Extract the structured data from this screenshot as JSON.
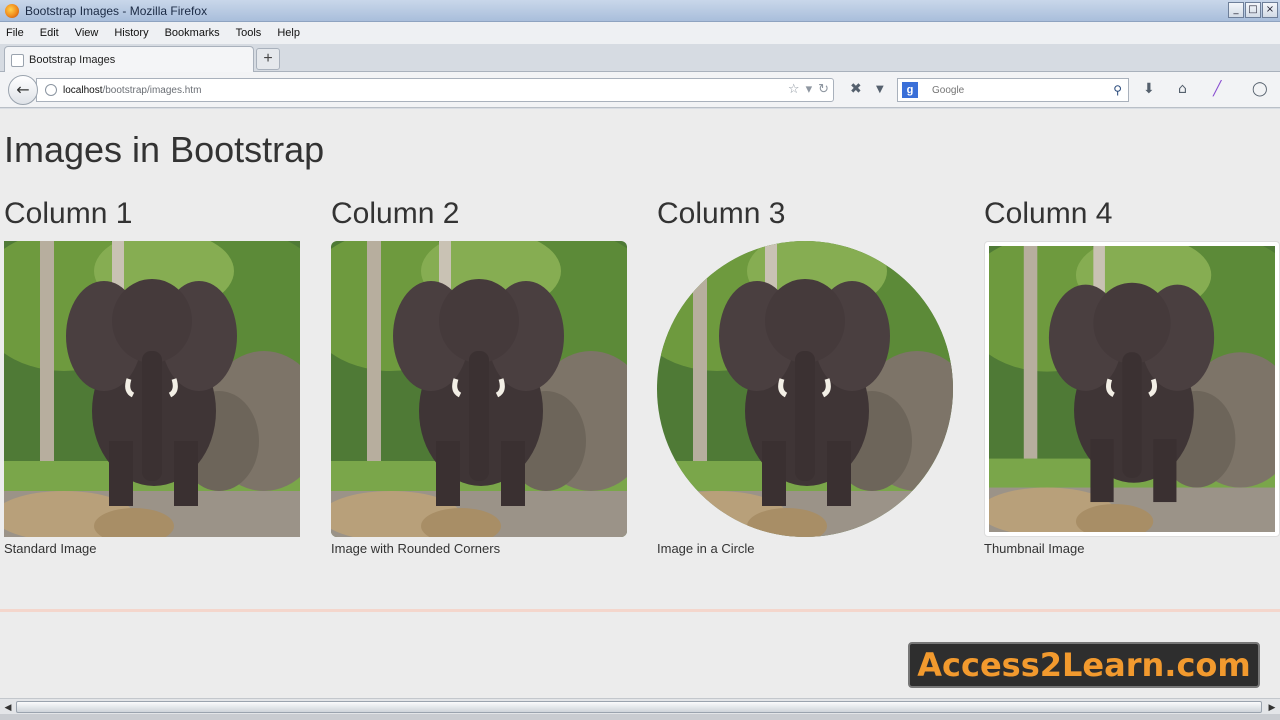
{
  "window": {
    "title": "Bootstrap Images - Mozilla Firefox"
  },
  "menu": [
    "File",
    "Edit",
    "View",
    "History",
    "Bookmarks",
    "Tools",
    "Help"
  ],
  "tab": {
    "label": "Bootstrap Images"
  },
  "nav": {
    "url_host": "localhost",
    "url_path": "/bootstrap/images.htm",
    "search_placeholder": "Google"
  },
  "page": {
    "heading": "Images in Bootstrap",
    "columns": [
      {
        "title": "Column 1",
        "caption": "Standard Image"
      },
      {
        "title": "Column 2",
        "caption": "Image with Rounded Corners"
      },
      {
        "title": "Column 3",
        "caption": "Image in a Circle"
      },
      {
        "title": "Column 4",
        "caption": "Thumbnail Image"
      }
    ]
  },
  "watermark": {
    "text": "Access2Learn.com"
  },
  "colors": {
    "accent": "#f29a2e",
    "background": "#ececec"
  }
}
